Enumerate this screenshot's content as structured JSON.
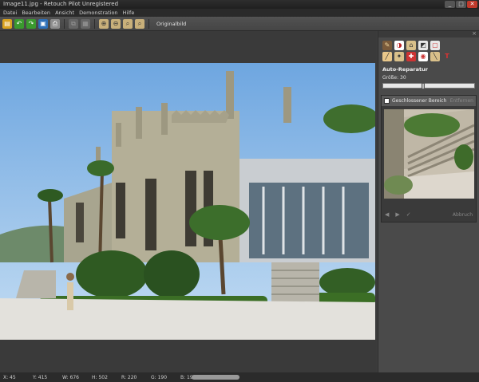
{
  "window": {
    "title": "Image11.jpg - Retouch Pilot Unregistered",
    "minimize": "_",
    "maximize": "□",
    "close": "✕"
  },
  "menu": [
    "Datei",
    "Bearbeiten",
    "Ansicht",
    "Demonstration",
    "Hilfe"
  ],
  "toolbar": {
    "icons": [
      "open-folder-icon",
      "undo-icon",
      "redo-icon",
      "save-icon",
      "print-icon",
      "copy-icon",
      "paste-icon",
      "zoom-in-icon",
      "zoom-out-icon",
      "zoom-fit-icon",
      "zoom-actual-icon"
    ],
    "original_label": "Originalbild"
  },
  "panel": {
    "close": "×",
    "tools": [
      "patch-tool-icon",
      "clone-tool-icon",
      "stamp-tool-icon",
      "crop-tool-icon",
      "select-tool-icon",
      "brush-tool-icon",
      "wand-tool-icon",
      "heal-tool-icon",
      "redeye-tool-icon",
      "line-tool-icon",
      "text-tool-icon"
    ],
    "section_title": "Auto-Reparatur",
    "size_label": "Größe: 30",
    "size_value": 30,
    "closed_area_label": "Geschlossener Bereich",
    "remove_label": "Entfernen",
    "apply_label": "Abbruch",
    "nav": [
      "◀",
      "▶",
      "✓"
    ]
  },
  "status": {
    "x": "X: 45",
    "y": "Y: 415",
    "w": "W: 676",
    "h": "H: 502",
    "r": "R: 220",
    "g": "G: 190",
    "b": "B: 192"
  },
  "colors": {
    "accent_green": "#3a9a2e",
    "close_red": "#c0392b"
  }
}
